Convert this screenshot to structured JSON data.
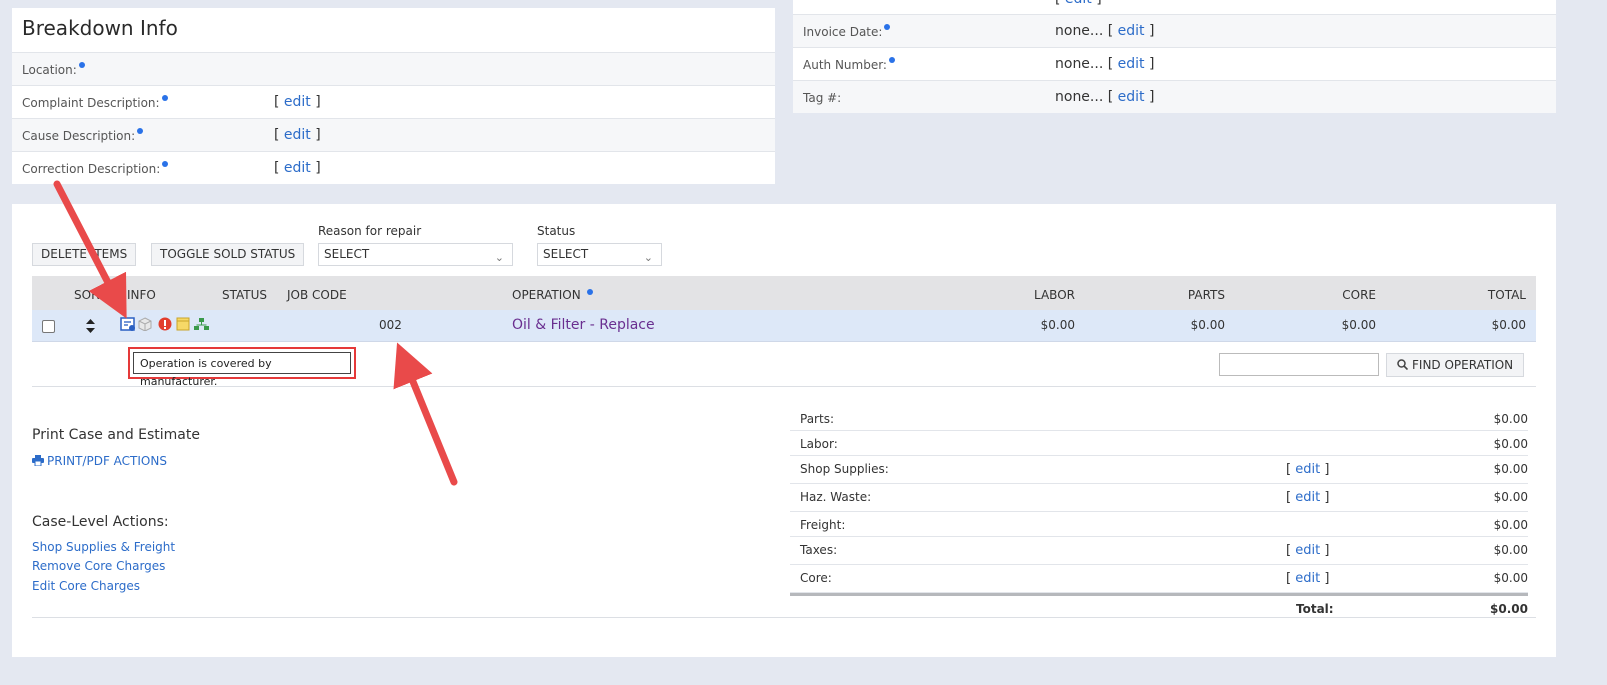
{
  "breakdown": {
    "title": "Breakdown Info",
    "rows": [
      {
        "label": "Location:",
        "value": ""
      },
      {
        "label": "Complaint Description:",
        "value": "edit"
      },
      {
        "label": "Cause Description:",
        "value": "edit"
      },
      {
        "label": "Correction Description:",
        "value": "edit"
      }
    ]
  },
  "invoice": {
    "top_cut_value": "edit",
    "rows": [
      {
        "label": "Invoice Date:",
        "value": "none...",
        "edit": "edit"
      },
      {
        "label": "Auth Number:",
        "value": "none...",
        "edit": "edit"
      },
      {
        "label": "Tag #:",
        "value": "none...",
        "edit": "edit"
      }
    ]
  },
  "toolbar": {
    "delete_label": "DELETE ITEMS",
    "toggle_label": "TOGGLE SOLD STATUS",
    "reason_label": "Reason for repair",
    "reason_value": "SELECT",
    "status_label": "Status",
    "status_value": "SELECT"
  },
  "table": {
    "headers": {
      "sort": "SORT",
      "info": "INFO",
      "status": "STATUS",
      "job_code": "JOB CODE",
      "operation": "OPERATION",
      "labor": "LABOR",
      "parts": "PARTS",
      "core": "CORE",
      "total": "TOTAL"
    },
    "row": {
      "job_code": "002",
      "operation": "Oil & Filter - Replace",
      "labor": "$0.00",
      "parts": "$0.00",
      "core": "$0.00",
      "total": "$0.00"
    },
    "info_icons": [
      "manufacturer-coverage-icon",
      "parts-box-icon",
      "alert-icon",
      "note-icon",
      "hierarchy-icon"
    ]
  },
  "tooltip": "Operation is covered by manufacturer.",
  "find": {
    "input_value": "",
    "button_label": "FIND OPERATION"
  },
  "print": {
    "heading": "Print Case and Estimate",
    "link": "PRINT/PDF ACTIONS"
  },
  "case_actions": {
    "heading": "Case-Level Actions:",
    "links": [
      "Shop Supplies & Freight",
      "Remove Core Charges",
      "Edit Core Charges"
    ]
  },
  "totals": [
    {
      "label": "Parts:",
      "edit": "",
      "value": "$0.00"
    },
    {
      "label": "Labor:",
      "edit": "",
      "value": "$0.00"
    },
    {
      "label": "Shop Supplies:",
      "edit": "edit",
      "value": "$0.00"
    },
    {
      "label": "Haz. Waste:",
      "edit": "edit",
      "value": "$0.00"
    },
    {
      "label": "Freight:",
      "edit": "",
      "value": "$0.00"
    },
    {
      "label": "Taxes:",
      "edit": "edit",
      "value": "$0.00"
    },
    {
      "label": "Core:",
      "edit": "edit",
      "value": "$0.00"
    }
  ],
  "grand_total": {
    "label": "Total:",
    "value": "$0.00"
  },
  "colors": {
    "accent": "#2c6cc9",
    "annotation": "#e53939",
    "operation_link": "#6a2f90",
    "row_highlight": "#dde8f8"
  }
}
